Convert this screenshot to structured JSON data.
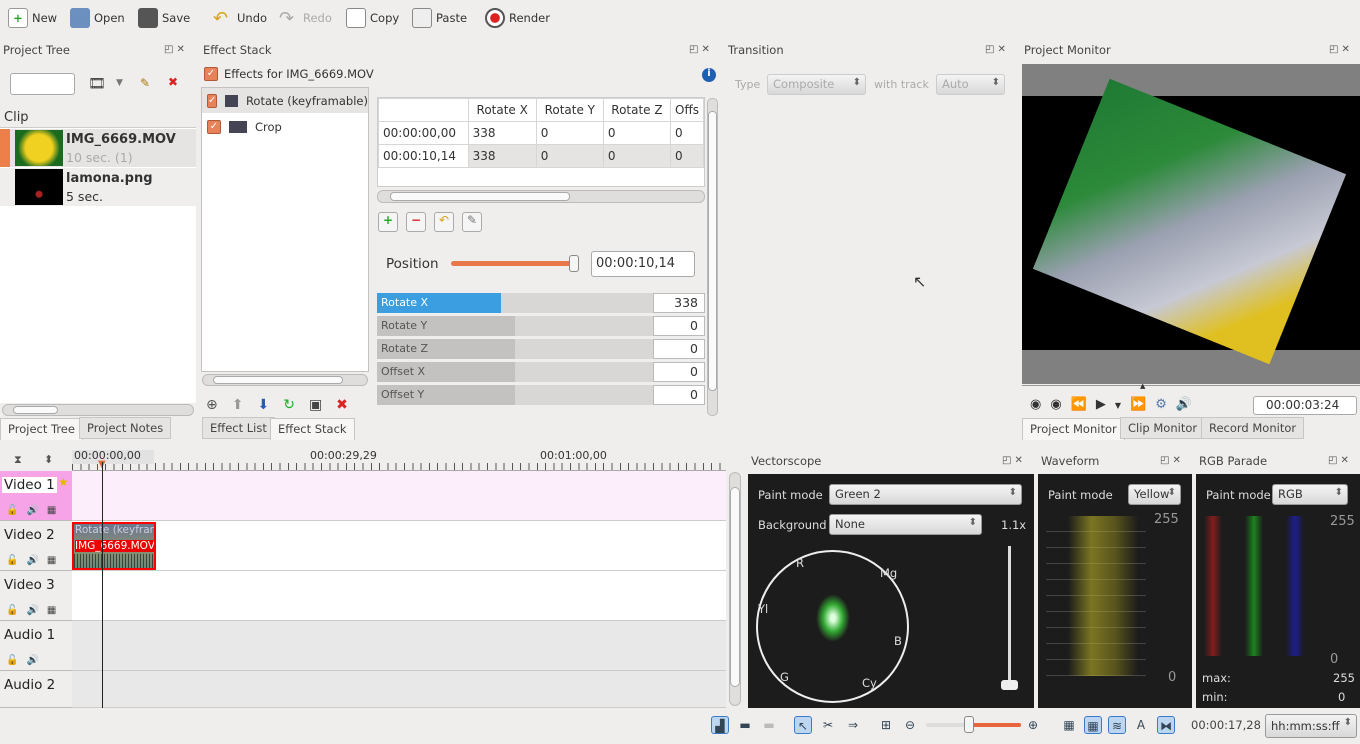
{
  "toolbar": {
    "new": "New",
    "open": "Open",
    "save": "Save",
    "undo": "Undo",
    "redo": "Redo",
    "copy": "Copy",
    "paste": "Paste",
    "render": "Render"
  },
  "project_tree": {
    "title": "Project Tree",
    "search_value": "",
    "column": "Clip",
    "clips": [
      {
        "name": "IMG_6669.MOV",
        "info": "10 sec. (1)"
      },
      {
        "name": "lamona.png",
        "info": "5 sec."
      }
    ],
    "tabs": [
      "Project Tree",
      "Project Notes"
    ]
  },
  "effect_stack": {
    "title": "Effect Stack",
    "effects_for": "Effects for IMG_6669.MOV",
    "effects": [
      "Rotate (keyframable)",
      "Crop"
    ],
    "table": {
      "headers": [
        "",
        "Rotate X",
        "Rotate Y",
        "Rotate Z",
        "Offs"
      ],
      "rows": [
        [
          "00:00:00,00",
          "338",
          "0",
          "0",
          "0"
        ],
        [
          "00:00:10,14",
          "338",
          "0",
          "0",
          "0"
        ]
      ]
    },
    "position_label": "Position",
    "position_value": "00:00:10,14",
    "position_fraction": 1.0,
    "params": [
      {
        "label": "Rotate X",
        "value": "338",
        "fraction": 0.45
      },
      {
        "label": "Rotate Y",
        "value": "0",
        "fraction": 0.5
      },
      {
        "label": "Rotate Z",
        "value": "0",
        "fraction": 0.5
      },
      {
        "label": "Offset X",
        "value": "0",
        "fraction": 0.5
      },
      {
        "label": "Offset Y",
        "value": "0",
        "fraction": 0.5
      }
    ],
    "tabs": [
      "Effect List",
      "Effect Stack"
    ]
  },
  "transition": {
    "title": "Transition",
    "type_label": "Type",
    "type_value": "Composite",
    "with_track_label": "with track",
    "track_value": "Auto"
  },
  "project_monitor": {
    "title": "Project Monitor",
    "timecode": "00:00:03:24",
    "tabs": [
      "Project Monitor",
      "Clip Monitor",
      "Record Monitor"
    ]
  },
  "timeline": {
    "ruler": [
      "00:00:00,00",
      "00:00:29,29",
      "00:01:00,00"
    ],
    "tracks": [
      "Video 1",
      "Video 2",
      "Video 3",
      "Audio 1",
      "Audio 2"
    ],
    "clip": {
      "effect": "Rotate (keyframable)",
      "name": "IMG_6669.MOV"
    }
  },
  "vectorscope": {
    "title": "Vectorscope",
    "paint_mode_label": "Paint mode",
    "paint_mode": "Green 2",
    "background_label": "Background",
    "background": "None",
    "gain": "1.1x",
    "targets": [
      "R",
      "Mg",
      "Yl",
      "B",
      "G",
      "Cy"
    ]
  },
  "waveform": {
    "title": "Waveform",
    "paint_mode_label": "Paint mode",
    "paint_mode": "Yellow",
    "max": "255",
    "min": "0"
  },
  "rgb_parade": {
    "title": "RGB Parade",
    "paint_mode_label": "Paint mode",
    "paint_mode": "RGB",
    "max": "255",
    "min": "0",
    "max_label": "max:",
    "min_label": "min:",
    "stat_max": "255",
    "stat_min": "0"
  },
  "statusbar": {
    "timecode": "00:00:17,28",
    "format": "hh:mm:ss:ff",
    "zoom_fraction": 0.45
  }
}
